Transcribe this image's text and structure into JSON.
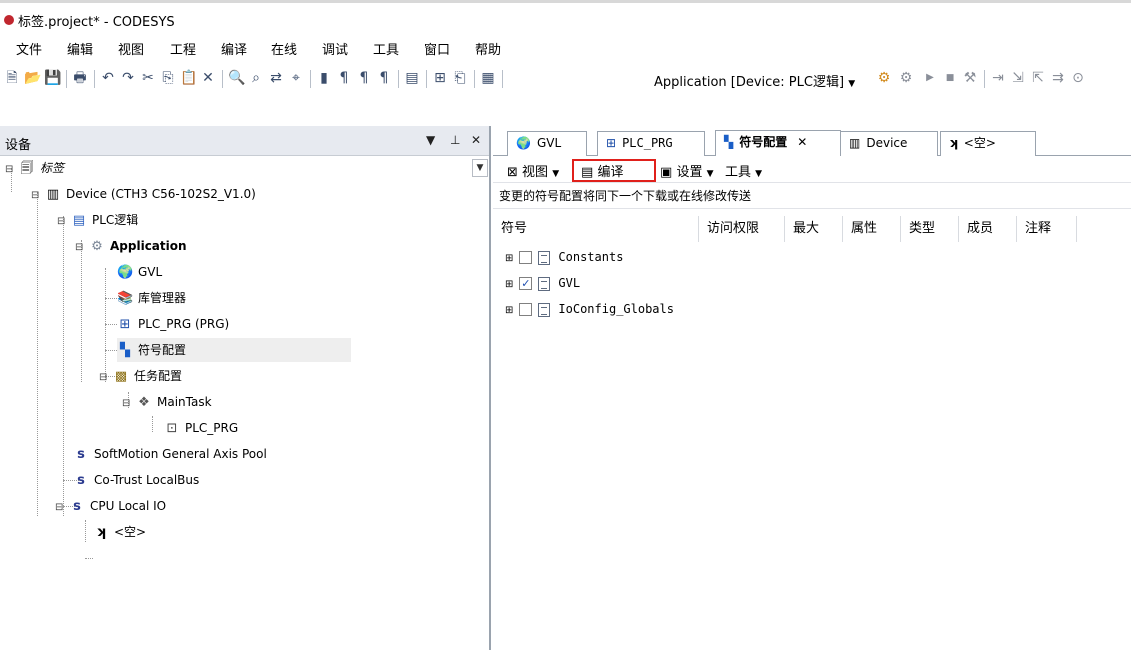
{
  "window": {
    "title": "标签.project* - CODESYS"
  },
  "menu": [
    "文件",
    "编辑",
    "视图",
    "工程",
    "编译",
    "在线",
    "调试",
    "工具",
    "窗口",
    "帮助"
  ],
  "toolbar": {
    "application_selector": "Application [Device: PLC逻辑]"
  },
  "devices_panel": {
    "title": "设备",
    "pin": "▾  ⊥",
    "close": "✕",
    "tree": [
      {
        "label": "标签",
        "icon": "project-icon"
      },
      {
        "label": "Device (CTH3 C56-102S2_V1.0)",
        "icon": "device-icon"
      },
      {
        "label": "PLC逻辑",
        "icon": "plc-logic-icon"
      },
      {
        "label": "Application",
        "icon": "application-gear-icon"
      },
      {
        "label": "GVL",
        "icon": "gvl-globe-icon"
      },
      {
        "label": "库管理器",
        "icon": "library-manager-icon"
      },
      {
        "label": "PLC_PRG (PRG)",
        "icon": "pou-icon"
      },
      {
        "label": "符号配置",
        "icon": "symbol-config-icon"
      },
      {
        "label": "任务配置",
        "icon": "task-config-icon"
      },
      {
        "label": "MainTask",
        "icon": "task-icon"
      },
      {
        "label": "PLC_PRG",
        "icon": "program-call-icon"
      },
      {
        "label": "SoftMotion General Axis Pool",
        "icon": "axis-pool-icon"
      },
      {
        "label": "Co-Trust LocalBus",
        "icon": "localbus-icon"
      },
      {
        "label": "CPU Local IO",
        "icon": "local-io-icon"
      },
      {
        "label": "<空>",
        "icon": "empty-slot-icon"
      }
    ]
  },
  "editor": {
    "tabs": [
      {
        "label": "GVL",
        "icon": "gvl-globe-icon"
      },
      {
        "label": "PLC_PRG",
        "icon": "pou-icon"
      },
      {
        "label": "符号配置",
        "icon": "symbol-config-icon",
        "active": true
      },
      {
        "label": "Device",
        "icon": "device-icon"
      },
      {
        "label": "<空>",
        "icon": "empty-slot-icon"
      }
    ],
    "tab_close": "✕",
    "doc_toolbar": {
      "view": "视图",
      "compile": "编译",
      "settings": "设置",
      "tools": "工具"
    },
    "info": "变更的符号配置将同下一个下载或在线修改传送",
    "columns": [
      "符号",
      "访问权限",
      "最大",
      "属性",
      "类型",
      "成员",
      "注释"
    ],
    "symbols": [
      {
        "name": "Constants",
        "checked": false
      },
      {
        "name": "GVL",
        "checked": true
      },
      {
        "name": "IoConfig_Globals",
        "checked": false
      }
    ]
  }
}
